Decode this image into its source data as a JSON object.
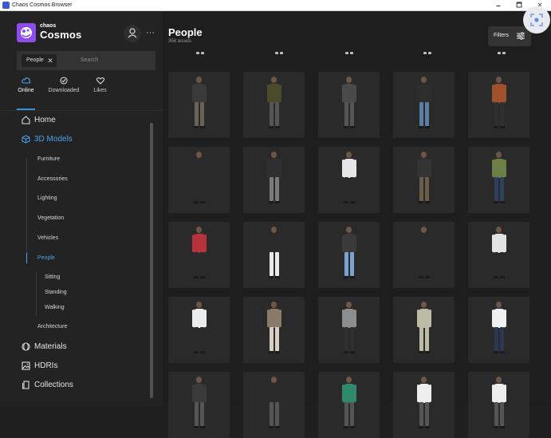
{
  "window": {
    "title": "Chaos Cosmos Browser",
    "minimize": "🗕",
    "maximize": "🗖",
    "close": "✕"
  },
  "brand": {
    "small": "chaos",
    "name": "Cosmos",
    "accent": "#8e4cf0"
  },
  "header": {
    "more": "···"
  },
  "search": {
    "chip": "People",
    "chip_remove": "✕",
    "placeholder": "Search"
  },
  "tabs": [
    {
      "label": "Online",
      "icon": "cloud-icon",
      "active": true
    },
    {
      "label": "Downloaded",
      "icon": "check-circle-icon",
      "active": false
    },
    {
      "label": "Likes",
      "icon": "heart-icon",
      "active": false
    }
  ],
  "nav": {
    "home": "Home",
    "models": "3D Models",
    "sub": [
      "Furniture",
      "Accessories",
      "Lighting",
      "Vegetation",
      "Vehicles",
      "People"
    ],
    "people_sub": [
      "Sitting",
      "Standing",
      "Walking"
    ],
    "architecture": "Architecture",
    "materials": "Materials",
    "hdris": "HDRIs",
    "collections": "Collections",
    "active_color": "#4aa3ef"
  },
  "main": {
    "title": "People",
    "count": "358 assets",
    "filters": "Filters"
  },
  "people_cards": [
    {
      "top": "#3a3a3a",
      "bottom": "#6b6355"
    },
    {
      "top": "#4b4a2a",
      "bottom": "#555555"
    },
    {
      "top": "#4a4a4a",
      "bottom": "#555555"
    },
    {
      "top": "#2e2e2e",
      "bottom": "#5b7da6"
    },
    {
      "top": "#a0522d",
      "bottom": "#2f2f2f"
    },
    {
      "top": "#2a2a2a",
      "bottom": "#2a2a2a"
    },
    {
      "top": "#2f2f2f",
      "bottom": "#7a7a7a"
    },
    {
      "top": "#e6e6e6",
      "bottom": "#2a2a2a"
    },
    {
      "top": "#343434",
      "bottom": "#6b5e4a"
    },
    {
      "top": "#6d7f45",
      "bottom": "#2f3f5e"
    },
    {
      "top": "#b8323b",
      "bottom": "#2a2a2a"
    },
    {
      "top": "#2b2b2b",
      "bottom": "#e8e8e8"
    },
    {
      "top": "#3a3a3a",
      "bottom": "#7ba3d1"
    },
    {
      "top": "#2a2a2a",
      "bottom": "#2a2a2a"
    },
    {
      "top": "#e3e3e3",
      "bottom": "#2a2a2a"
    },
    {
      "top": "#ececec",
      "bottom": "#2a2a2a"
    },
    {
      "top": "#8a7a68",
      "bottom": "#d8d0c2"
    },
    {
      "top": "#8d8d8d",
      "bottom": "#2f2f2f"
    },
    {
      "top": "#bdbba4",
      "bottom": "#bdbba4"
    },
    {
      "top": "#f0f0f0",
      "bottom": "#2f3653"
    },
    {
      "top": "#3a3a3a",
      "bottom": "#555555"
    },
    {
      "top": "#2a2a2a",
      "bottom": "#555555"
    },
    {
      "top": "#2f8a6d",
      "bottom": "#555555"
    },
    {
      "top": "#ededed",
      "bottom": "#555555"
    },
    {
      "top": "#ededed",
      "bottom": "#555555"
    }
  ]
}
